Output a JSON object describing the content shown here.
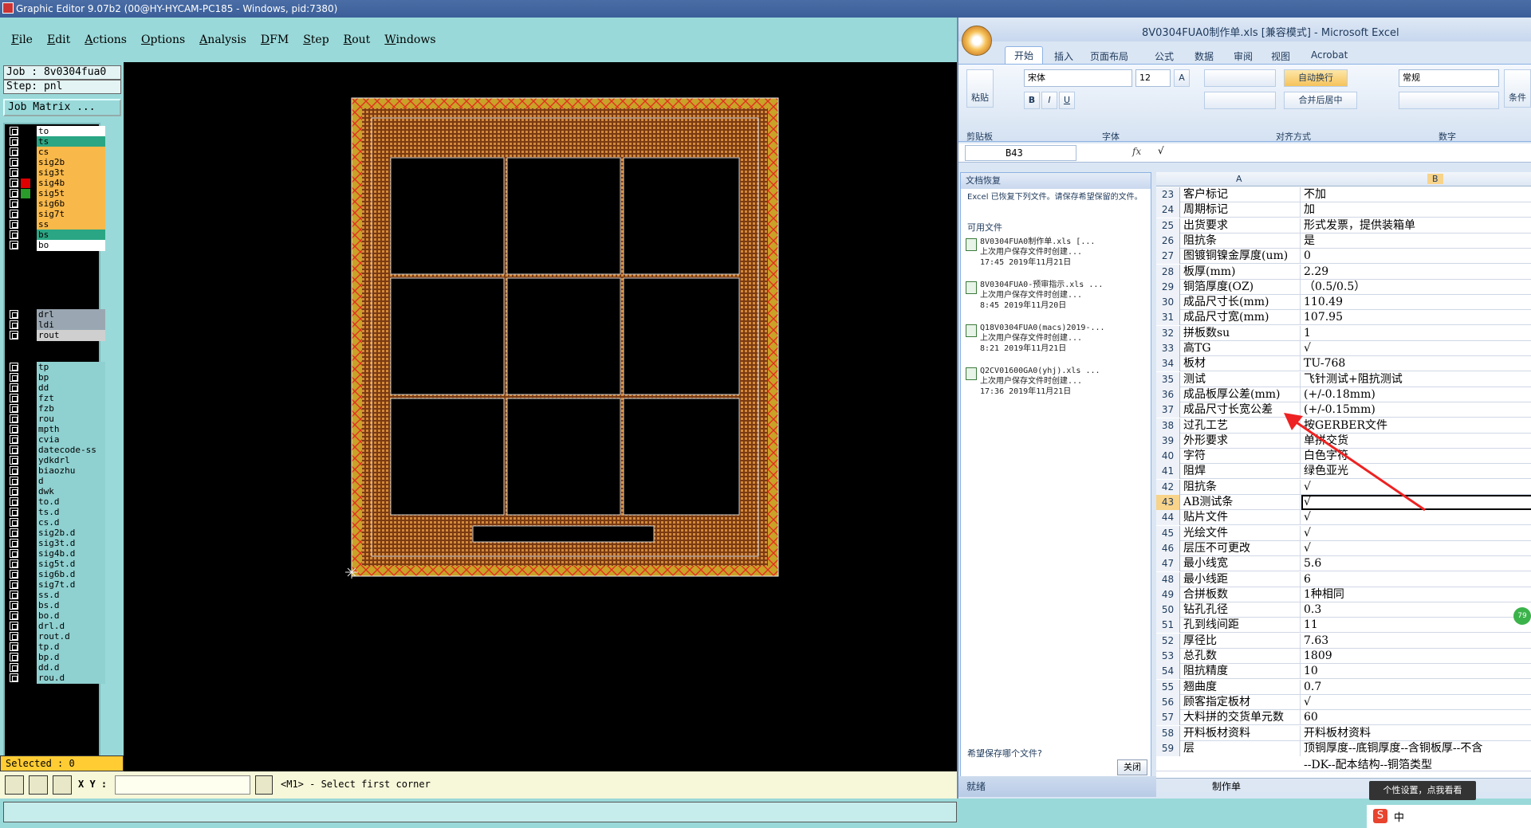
{
  "ge": {
    "title": "Graphic Editor 9.07b2 (00@HY-HYCAM-PC185 - Windows, pid:7380)",
    "menu": [
      "File",
      "Edit",
      "Actions",
      "Options",
      "Analysis",
      "DFM",
      "Step",
      "Rout",
      "Windows"
    ],
    "job": "Job : 8v0304fua0",
    "step": "Step: pnl",
    "job_matrix": "Job Matrix ...",
    "layers_group1": [
      {
        "name": "to",
        "swatch": "#000000",
        "color": "#ffffff"
      },
      {
        "name": "ts",
        "swatch": "#000000",
        "color": "#2aa684"
      },
      {
        "name": "cs",
        "swatch": "#000000",
        "color": "#f8b84a"
      },
      {
        "name": "sig2b",
        "swatch": "#000000",
        "color": "#f8b84a"
      },
      {
        "name": "sig3t",
        "swatch": "#000000",
        "color": "#f8b84a"
      },
      {
        "name": "sig4b",
        "swatch": "#e00000",
        "color": "#f8b84a"
      },
      {
        "name": "sig5t",
        "swatch": "#2a9a2a",
        "color": "#f8b84a"
      },
      {
        "name": "sig6b",
        "swatch": "#000000",
        "color": "#f8b84a"
      },
      {
        "name": "sig7t",
        "swatch": "#000000",
        "color": "#f8b84a"
      },
      {
        "name": "ss",
        "swatch": "#000000",
        "color": "#f8b84a"
      },
      {
        "name": "bs",
        "swatch": "#000000",
        "color": "#2aa684"
      },
      {
        "name": "bo",
        "swatch": "#000000",
        "color": "#ffffff"
      }
    ],
    "layers_group2": [
      {
        "name": "drl",
        "color": "#9aa7b2"
      },
      {
        "name": "ldi",
        "color": "#9aa7b2"
      },
      {
        "name": "rout",
        "color": "#cfcfcf"
      }
    ],
    "layers_group3": [
      "tp",
      "bp",
      "dd",
      "fzt",
      "fzb",
      "rou",
      "mpth",
      "cvia",
      "datecode-ss",
      "ydkdrl",
      "biaozhu",
      "d",
      "dwk",
      "to.d",
      "ts.d",
      "cs.d",
      "sig2b.d",
      "sig3t.d",
      "sig4b.d",
      "sig5t.d",
      "sig6b.d",
      "sig7t.d",
      "ss.d",
      "bs.d",
      "bo.d",
      "drl.d",
      "rout.d",
      "tp.d",
      "bp.d",
      "dd.d",
      "rou.d"
    ],
    "selected": "Selected : 0",
    "xy_label": "X Y :",
    "prompt": "<M1> - Select first corner"
  },
  "excel": {
    "title": "8V0304FUA0制作单.xls [兼容模式] - Microsoft Excel",
    "tabs": [
      "开始",
      "插入",
      "页面布局",
      "公式",
      "数据",
      "审阅",
      "视图",
      "Acrobat"
    ],
    "paste": "粘贴",
    "font_name": "宋体",
    "font_size": "12",
    "wrap_text": "自动换行",
    "merge": "合并后居中",
    "number_format": "常规",
    "conditional": "条件",
    "groups": [
      "剪贴板",
      "字体",
      "对齐方式",
      "数字"
    ],
    "name_box": "B43",
    "formula_value": "√",
    "recovery": {
      "header": "文档恢复",
      "desc": "Excel 已恢复下列文件。请保存希望保留的文件。",
      "available": "可用文件",
      "files": [
        {
          "name": "8V0304FUA0制作单.xls [...",
          "line2": "上次用户保存文件时创建...",
          "line3": "17:45 2019年11月21日"
        },
        {
          "name": "8V0304FUA0-预审指示.xls ...",
          "line2": "上次用户保存文件时创建...",
          "line3": "8:45 2019年11月20日"
        },
        {
          "name": "Q18V0304FUA0(macs)2019-...",
          "line2": "上次用户保存文件时创建...",
          "line3": "8:21 2019年11月21日"
        },
        {
          "name": "Q2CV01600GA0(yhj).xls ...",
          "line2": "上次用户保存文件时创建...",
          "line3": "17:36 2019年11月21日"
        }
      ],
      "question": "希望保存哪个文件?",
      "close": "关闭"
    },
    "col_a": "A",
    "col_b": "B",
    "rows": [
      {
        "n": "23",
        "a": "客户标记",
        "b": "不加"
      },
      {
        "n": "24",
        "a": "周期标记",
        "b": "加"
      },
      {
        "n": "25",
        "a": "出货要求",
        "b": "形式发票，提供装箱单"
      },
      {
        "n": "26",
        "a": "阻抗条",
        "b": "是"
      },
      {
        "n": "27",
        "a": "图镀铜镍金厚度(um)",
        "b": "0"
      },
      {
        "n": "28",
        "a": "板厚(mm)",
        "b": "2.29"
      },
      {
        "n": "29",
        "a": "铜箔厚度(OZ)",
        "b": "（0.5/0.5）"
      },
      {
        "n": "30",
        "a": "成品尺寸长(mm)",
        "b": "110.49"
      },
      {
        "n": "31",
        "a": "成品尺寸宽(mm)",
        "b": "107.95"
      },
      {
        "n": "32",
        "a": "拼板数su",
        "b": "1"
      },
      {
        "n": "33",
        "a": "高TG",
        "b": "√"
      },
      {
        "n": "34",
        "a": "板材",
        "b": "TU-768"
      },
      {
        "n": "35",
        "a": "测试",
        "b": "飞针测试+阻抗测试"
      },
      {
        "n": "36",
        "a": "成品板厚公差(mm)",
        "b": "(+/-0.18mm)"
      },
      {
        "n": "37",
        "a": "成品尺寸长宽公差",
        "b": "(+/-0.15mm)"
      },
      {
        "n": "38",
        "a": "过孔工艺",
        "b": "按GERBER文件"
      },
      {
        "n": "39",
        "a": "外形要求",
        "b": "单拼交货"
      },
      {
        "n": "40",
        "a": "字符",
        "b": "白色字符"
      },
      {
        "n": "41",
        "a": "阻焊",
        "b": "绿色亚光"
      },
      {
        "n": "42",
        "a": "阻抗条",
        "b": "√"
      },
      {
        "n": "43",
        "a": "AB测试条",
        "b": "√"
      },
      {
        "n": "44",
        "a": "贴片文件",
        "b": "√"
      },
      {
        "n": "45",
        "a": "光绘文件",
        "b": "√"
      },
      {
        "n": "46",
        "a": "层压不可更改",
        "b": "√"
      },
      {
        "n": "47",
        "a": "最小线宽",
        "b": "5.6"
      },
      {
        "n": "48",
        "a": "最小线距",
        "b": "6"
      },
      {
        "n": "49",
        "a": "合拼板数",
        "b": "1种相同"
      },
      {
        "n": "50",
        "a": "钻孔孔径",
        "b": "0.3"
      },
      {
        "n": "51",
        "a": "孔到线间距",
        "b": "11"
      },
      {
        "n": "52",
        "a": "厚径比",
        "b": "7.63"
      },
      {
        "n": "53",
        "a": "总孔数",
        "b": "1809"
      },
      {
        "n": "54",
        "a": "阻抗精度",
        "b": "10"
      },
      {
        "n": "55",
        "a": "翘曲度",
        "b": "0.7"
      },
      {
        "n": "56",
        "a": "顾客指定板材",
        "b": "√"
      },
      {
        "n": "57",
        "a": "大料拼的交货单元数",
        "b": "60"
      },
      {
        "n": "58",
        "a": "开料板材资料",
        "b": "开料板材资料"
      },
      {
        "n": "59",
        "a": "层",
        "b": "顶铜厚度--底铜厚度--含铜板厚--不含"
      }
    ],
    "row59_line2": "--DK--配本结构--铜箔类型",
    "sheet_tab": "制作单",
    "status": "就绪",
    "badge": "79"
  },
  "tooltip": "个性设置，点我看看",
  "ime": "中"
}
